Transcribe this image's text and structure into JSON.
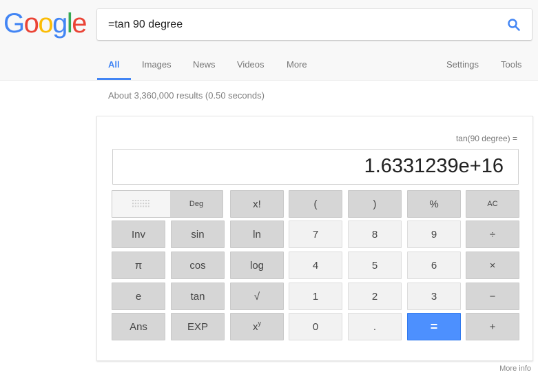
{
  "logo": {
    "letters": [
      {
        "ch": "G",
        "color": "#4285f4"
      },
      {
        "ch": "o",
        "color": "#ea4335"
      },
      {
        "ch": "o",
        "color": "#fbbc05"
      },
      {
        "ch": "g",
        "color": "#4285f4"
      },
      {
        "ch": "l",
        "color": "#34a853"
      },
      {
        "ch": "e",
        "color": "#ea4335"
      }
    ]
  },
  "search": {
    "value": "=tan 90 degree",
    "icon": "search-icon",
    "accent": "#4285f4"
  },
  "tabs": [
    {
      "label": "All",
      "active": true
    },
    {
      "label": "Images",
      "active": false
    },
    {
      "label": "News",
      "active": false
    },
    {
      "label": "Videos",
      "active": false
    },
    {
      "label": "More",
      "active": false
    }
  ],
  "tools": {
    "settings": "Settings",
    "tools": "Tools"
  },
  "result_stats": "About 3,360,000 results (0.50 seconds)",
  "calculator": {
    "expression": "tan(90 degree) =",
    "display": "1.6331239e+16",
    "mode": {
      "rad_icon": "dotted-grid-icon",
      "deg": "Deg",
      "selected": "Deg"
    },
    "rows": [
      [
        {
          "label": "x!",
          "style": "dark"
        },
        {
          "label": "(",
          "style": "dark"
        },
        {
          "label": ")",
          "style": "dark"
        },
        {
          "label": "%",
          "style": "dark"
        },
        {
          "label": "AC",
          "style": "dark"
        }
      ],
      [
        {
          "label": "Inv",
          "style": "dark"
        },
        {
          "label": "sin",
          "style": "dark"
        },
        {
          "label": "ln",
          "style": "dark"
        },
        {
          "label": "7",
          "style": "light"
        },
        {
          "label": "8",
          "style": "light"
        },
        {
          "label": "9",
          "style": "light"
        },
        {
          "label": "÷",
          "style": "dark"
        }
      ],
      [
        {
          "label": "π",
          "style": "dark"
        },
        {
          "label": "cos",
          "style": "dark"
        },
        {
          "label": "log",
          "style": "dark"
        },
        {
          "label": "4",
          "style": "light"
        },
        {
          "label": "5",
          "style": "light"
        },
        {
          "label": "6",
          "style": "light"
        },
        {
          "label": "×",
          "style": "dark"
        }
      ],
      [
        {
          "label": "e",
          "style": "dark"
        },
        {
          "label": "tan",
          "style": "dark"
        },
        {
          "label": "√",
          "style": "dark"
        },
        {
          "label": "1",
          "style": "light"
        },
        {
          "label": "2",
          "style": "light"
        },
        {
          "label": "3",
          "style": "light"
        },
        {
          "label": "−",
          "style": "dark"
        }
      ],
      [
        {
          "label": "Ans",
          "style": "dark"
        },
        {
          "label": "EXP",
          "style": "dark"
        },
        {
          "label": "xʸ",
          "style": "dark"
        },
        {
          "label": "0",
          "style": "light"
        },
        {
          "label": ".",
          "style": "light"
        },
        {
          "label": "=",
          "style": "blue"
        },
        {
          "label": "+",
          "style": "dark"
        }
      ]
    ],
    "equals_color": "#4d90fe"
  },
  "more_info": "More info"
}
